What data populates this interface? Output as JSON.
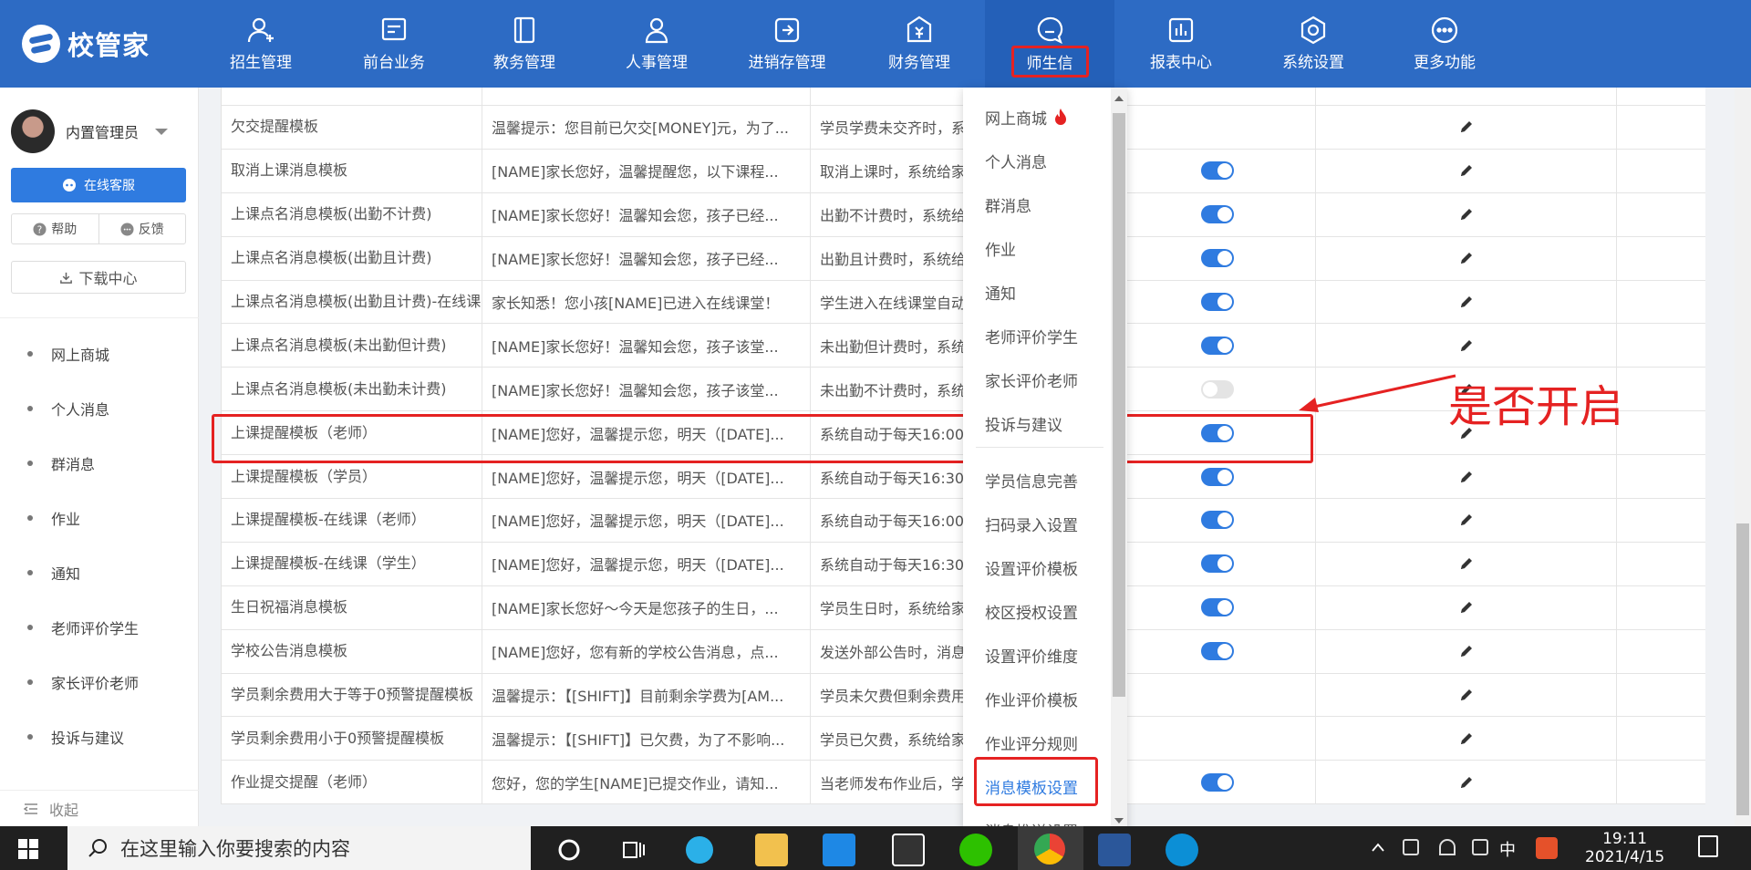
{
  "app": {
    "brand": "校管家",
    "nav": [
      {
        "label": "招生管理",
        "icon": "user-plus-icon"
      },
      {
        "label": "前台业务",
        "icon": "monitor-icon"
      },
      {
        "label": "教务管理",
        "icon": "book-icon"
      },
      {
        "label": "人事管理",
        "icon": "person-icon"
      },
      {
        "label": "进销存管理",
        "icon": "exchange-icon"
      },
      {
        "label": "财务管理",
        "icon": "finance-icon"
      },
      {
        "label": "师生信",
        "icon": "chat-icon",
        "active": true
      },
      {
        "label": "报表中心",
        "icon": "bar-chart-icon"
      },
      {
        "label": "系统设置",
        "icon": "settings-icon"
      },
      {
        "label": "更多功能",
        "icon": "more-icon"
      }
    ]
  },
  "sidebar": {
    "user_name": "内置管理员",
    "service_button": "在线客服",
    "help": "帮助",
    "feedback": "反馈",
    "download": "下载中心",
    "items": [
      "网上商城",
      "个人消息",
      "群消息",
      "作业",
      "通知",
      "老师评价学生",
      "家长评价老师",
      "投诉与建议"
    ],
    "collapse": "收起"
  },
  "table": {
    "rows": [
      {
        "name": "欠交提醒模板",
        "content": "温馨提示：您目前已欠交[MONEY]元，为了...",
        "desc": "学员学费未交齐时，系",
        "enabled": null
      },
      {
        "name": "取消上课消息模板",
        "content": "[NAME]家长您好，温馨提醒您，以下课程...",
        "desc": "取消上课时，系统给家",
        "enabled": true
      },
      {
        "name": "上课点名消息模板(出勤不计费)",
        "content": "[NAME]家长您好！温馨知会您，孩子已经...",
        "desc": "出勤不计费时，系统给",
        "enabled": true
      },
      {
        "name": "上课点名消息模板(出勤且计费)",
        "content": "[NAME]家长您好！温馨知会您，孩子已经...",
        "desc": "出勤且计费时，系统给",
        "enabled": true
      },
      {
        "name": "上课点名消息模板(出勤且计费)-在线课",
        "content": "家长知悉！您小孩[NAME]已进入在线课堂！",
        "desc": "学生进入在线课堂自动",
        "enabled": true
      },
      {
        "name": "上课点名消息模板(未出勤但计费)",
        "content": "[NAME]家长您好！温馨知会您，孩子该堂...",
        "desc": "未出勤但计费时，系统",
        "enabled": true
      },
      {
        "name": "上课点名消息模板(未出勤未计费)",
        "content": "[NAME]家长您好！温馨知会您，孩子该堂...",
        "desc": "未出勤不计费时，系统",
        "enabled": false
      },
      {
        "name": "上课提醒模板（老师）",
        "content": "[NAME]您好，温馨提示您，明天（[DATE]...",
        "desc": "系统自动于每天16:00",
        "enabled": true
      },
      {
        "name": "上课提醒模板（学员）",
        "content": "[NAME]您好，温馨提示您，明天（[DATE]...",
        "desc": "系统自动于每天16:30",
        "enabled": true
      },
      {
        "name": "上课提醒模板-在线课（老师）",
        "content": "[NAME]您好，温馨提示您，明天（[DATE]...",
        "desc": "系统自动于每天16:00",
        "enabled": true
      },
      {
        "name": "上课提醒模板-在线课（学生）",
        "content": "[NAME]您好，温馨提示您，明天（[DATE]...",
        "desc": "系统自动于每天16:30",
        "enabled": true
      },
      {
        "name": "生日祝福消息模板",
        "content": "[NAME]家长您好～今天是您孩子的生日，...",
        "desc": "学员生日时，系统给家",
        "enabled": true
      },
      {
        "name": "学校公告消息模板",
        "content": "[NAME]您好，您有新的学校公告消息，点...",
        "desc": "发送外部公告时，消息",
        "enabled": true
      },
      {
        "name": "学员剩余费用大于等于0预警提醒模板",
        "content": "温馨提示：【[SHIFT]】目前剩余学费为[AM...",
        "desc": "学员未欠费但剩余费用",
        "enabled": null
      },
      {
        "name": "学员剩余费用小于0预警提醒模板",
        "content": "温馨提示：【[SHIFT]】已欠费，为了不影响...",
        "desc": "学员已欠费，系统给家",
        "enabled": null
      },
      {
        "name": "作业提交提醒（老师）",
        "content": "您好，您的学生[NAME]已提交作业，请知...",
        "desc": "当老师发布作业后，学",
        "enabled": true
      }
    ]
  },
  "dropdown": {
    "items": [
      "网上商城",
      "个人消息",
      "群消息",
      "作业",
      "通知",
      "老师评价学生",
      "家长评价老师",
      "投诉与建议",
      "学员信息完善",
      "扫码录入设置",
      "设置评价模板",
      "校区授权设置",
      "设置评价维度",
      "作业评价模板",
      "作业评分规则",
      "消息模板设置",
      "消息推送设置"
    ],
    "active": "消息模板设置"
  },
  "annotation": {
    "text": "是否开启"
  },
  "taskbar": {
    "search_placeholder": "在这里输入你要搜索的内容",
    "time": "19:11",
    "date": "2021/4/15",
    "ime": "中"
  },
  "colors": {
    "brand": "#2d6bc4",
    "accent": "#2f7be0",
    "highlight": "#e52222"
  }
}
